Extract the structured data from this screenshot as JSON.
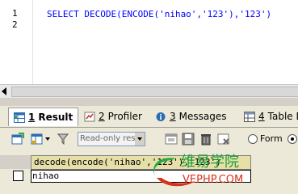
{
  "editor": {
    "line_numbers": [
      "1",
      "2"
    ],
    "sql_text": "SELECT DECODE(ENCODE('nihao','123'),'123')"
  },
  "result_tabs": [
    {
      "num": "1",
      "label": "Result",
      "icon": "grid-icon",
      "active": true
    },
    {
      "num": "2",
      "label": "Profiler",
      "icon": "profiler-icon",
      "active": false
    },
    {
      "num": "3",
      "label": "Messages",
      "icon": "info-icon",
      "active": false
    },
    {
      "num": "4",
      "label": "Table D",
      "icon": "table-icon",
      "active": false
    }
  ],
  "toolbar": {
    "mode_select": "Read-only res",
    "form_label": "Form"
  },
  "grid": {
    "column_header": "decode(encode('nihao','123'),'123')",
    "rows": [
      [
        "nihao"
      ]
    ]
  },
  "watermark": {
    "brand_cn": "维易学院",
    "brand_url": "VEPHP.COM",
    "colors": {
      "green": "#22aa44",
      "red": "#d8321e"
    }
  }
}
